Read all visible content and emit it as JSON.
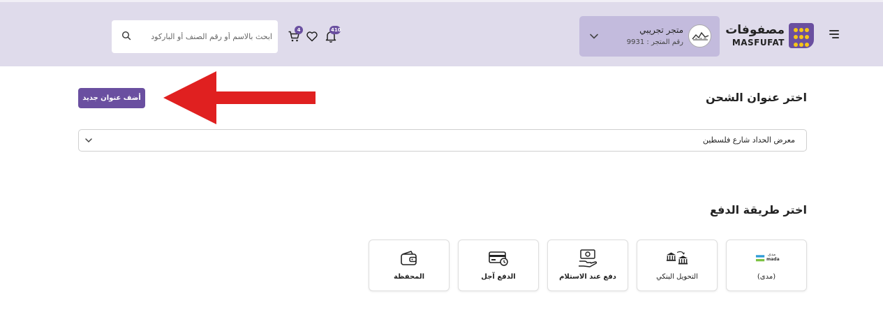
{
  "header": {
    "logo": {
      "text_ar": "مصفوفات",
      "text_en": "MASFUFAT"
    },
    "store": {
      "name": "متجر تجريبي",
      "number": "رقم المتجر : 9931"
    },
    "notifications_count": "410",
    "cart_count": "4",
    "search": {
      "placeholder": "ابحث بالاسم أو رقم الصنف أو الباركود"
    }
  },
  "shipping": {
    "title": "اختر عنوان الشحن",
    "add_button": "أضف عنوان جديد",
    "selected_address": "معرض الحداد شارع فلسطين"
  },
  "payment": {
    "title": "اختر طريقة الدفع",
    "methods": [
      {
        "label": "(مدى)",
        "icon": "mada-logo-icon",
        "logo_ar": "مدى",
        "logo_en": "mada"
      },
      {
        "label": "التحويل البنكي",
        "icon": "bank-transfer-icon"
      },
      {
        "label": "دفع عند الاستلام",
        "icon": "cash-on-delivery-icon"
      },
      {
        "label": "الدفع آجل",
        "icon": "deferred-payment-icon"
      },
      {
        "label": "المحفظة",
        "icon": "wallet-icon"
      }
    ]
  },
  "colors": {
    "header_bg": "#dfdbeb",
    "store_bg": "#c3bbdd",
    "accent": "#6a4fa0",
    "arrow": "#e02020"
  }
}
